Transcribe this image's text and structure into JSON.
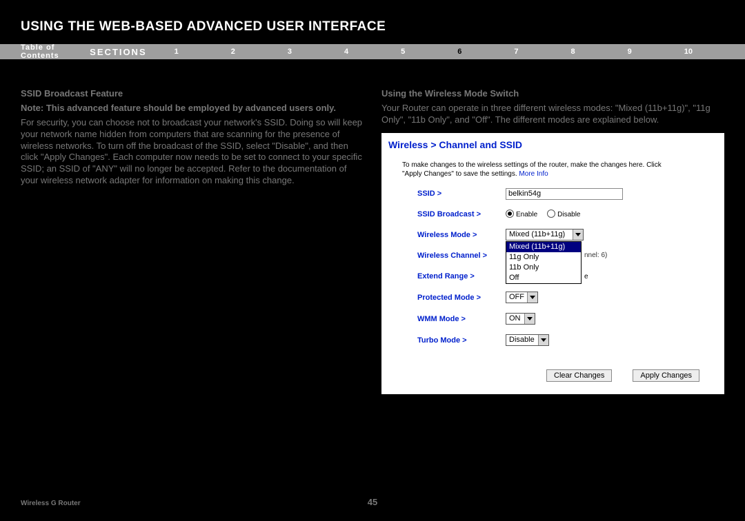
{
  "title": "USING THE WEB-BASED ADVANCED USER INTERFACE",
  "nav": {
    "toc": "Table of Contents",
    "sections_label": "SECTIONS",
    "links": [
      "1",
      "2",
      "3",
      "4",
      "5",
      "6",
      "7",
      "8",
      "9",
      "10"
    ],
    "current": "6"
  },
  "left": {
    "h1": "SSID Broadcast Feature",
    "note": "Note: This advanced feature should be employed by advanced users only.",
    "body": "For security, you can choose not to broadcast your network's SSID. Doing so will keep your network name hidden from computers that are scanning for the presence of wireless networks. To turn off the broadcast of the SSID, select \"Disable\", and then click \"Apply Changes\". Each computer now needs to be set to connect to your specific SSID; an SSID of \"ANY\" will no longer be accepted. Refer to the documentation of your wireless network adapter for information on making this change."
  },
  "right": {
    "h1": "Using the Wireless Mode Switch",
    "body": "Your Router can operate in three different wireless modes: \"Mixed (11b+11g)\", \"11g Only\", \"11b Only\", and \"Off\". The different modes are explained below."
  },
  "panel": {
    "title": "Wireless > Channel and SSID",
    "desc": "To make changes to the wireless settings of the router, make the changes here. Click \"Apply Changes\" to save the settings.",
    "more_info": "More Info",
    "rows": {
      "ssid": {
        "label": "SSID >",
        "value": "belkin54g"
      },
      "ssid_broadcast": {
        "label": "SSID Broadcast >",
        "enable": "Enable",
        "disable": "Disable",
        "selected": "enable"
      },
      "wireless_mode": {
        "label": "Wireless Mode >",
        "selected": "Mixed (11b+11g)",
        "options": [
          "Mixed (11b+11g)",
          "11g Only",
          "11b Only",
          "Off"
        ]
      },
      "wireless_channel": {
        "label": "Wireless Channel >",
        "current_note": "nnel: 6)"
      },
      "extend_range": {
        "label": "Extend Range >",
        "trail": "e"
      },
      "protected_mode": {
        "label": "Protected Mode >",
        "value": "OFF"
      },
      "wmm_mode": {
        "label": "WMM Mode >",
        "value": "ON"
      },
      "turbo_mode": {
        "label": "Turbo Mode >",
        "value": "Disable"
      }
    },
    "buttons": {
      "clear": "Clear Changes",
      "apply": "Apply Changes"
    }
  },
  "footer": {
    "product": "Wireless G Router",
    "page": "45"
  }
}
